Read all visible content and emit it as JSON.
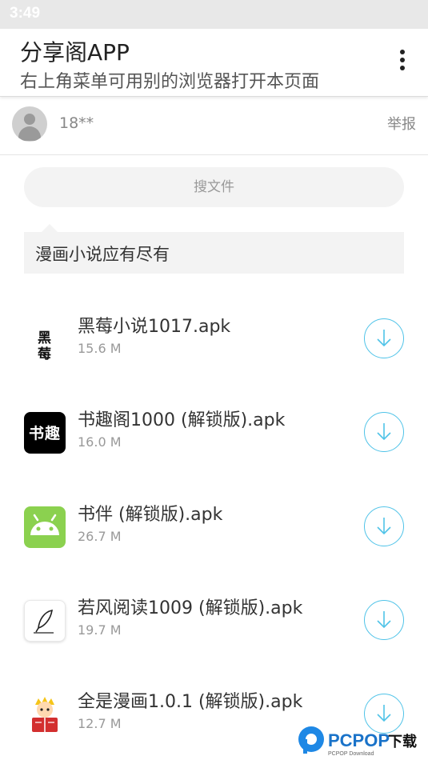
{
  "status_bar": {
    "time": "3:49"
  },
  "header": {
    "title": "分享阁APP",
    "subtitle": "右上角菜单可用别的浏览器打开本页面",
    "menu_icon": "more-vert-icon"
  },
  "user": {
    "name": "18**",
    "report_label": "举报",
    "avatar_icon": "default-avatar-icon"
  },
  "search": {
    "label": "搜文件"
  },
  "message": {
    "text": "漫画小说应有尽有"
  },
  "files": [
    {
      "name": "黑莓小说1017.apk",
      "size": "15.6 M",
      "icon": "heimei-app-icon",
      "icon_text": [
        "黑",
        "莓"
      ]
    },
    {
      "name": "书趣阁1000 (解锁版).apk",
      "size": "16.0 M",
      "icon": "shuqu-app-icon",
      "icon_text": "书趣"
    },
    {
      "name": "书伴 (解锁版).apk",
      "size": "26.7 M",
      "icon": "android-app-icon"
    },
    {
      "name": "若风阅读1009 (解锁版).apk",
      "size": "19.7 M",
      "icon": "feather-pen-app-icon"
    },
    {
      "name": "全是漫画1.0.1 (解锁版).apk",
      "size": "12.7 M",
      "icon": "comic-reader-app-icon"
    }
  ],
  "watermark": {
    "brand": "PCPOP下载",
    "tagline": "PCPOP Download"
  },
  "colors": {
    "accent": "#4fc3e8",
    "android_green": "#8bd14f",
    "statusbar": "#e8e8e8"
  }
}
